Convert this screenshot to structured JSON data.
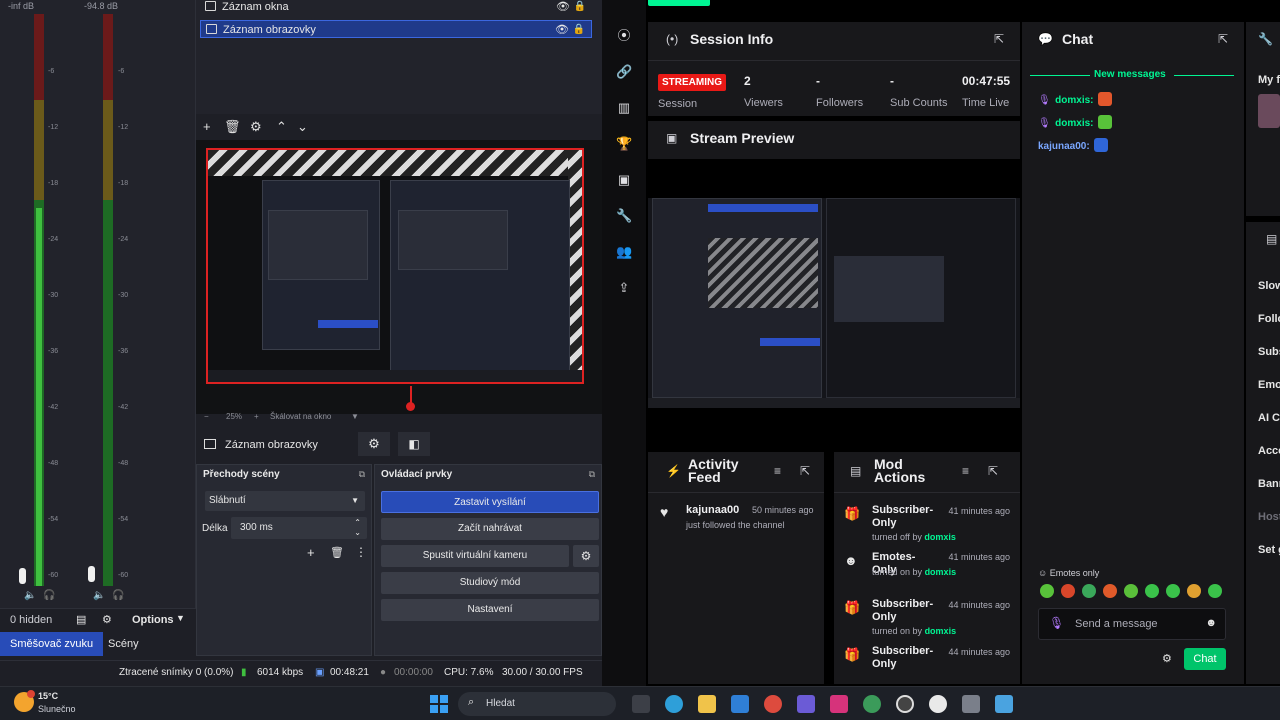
{
  "obs": {
    "mixer": {
      "meter1_head": "-inf dB",
      "meter2_head": "-94.8 dB",
      "ticks": [
        "-6",
        "-12",
        "-18",
        "-24",
        "-30",
        "-36",
        "-42",
        "-48",
        "-54",
        "-60"
      ],
      "hidden_label": "0 hidden",
      "options_label": "Options",
      "tab_mixer": "Směšovač zvuku",
      "tab_scenes": "Scény"
    },
    "sources": [
      {
        "label": "Záznam okna",
        "selected": false
      },
      {
        "label": "Záznam obrazovky",
        "selected": true
      }
    ],
    "zoom": {
      "percent": "25%",
      "scale_label": "Škálovat na okno"
    },
    "scene_source_label": "Záznam obrazovky",
    "transitions": {
      "title": "Přechody scény",
      "selected": "Slábnutí",
      "duration_label": "Délka",
      "duration_value": "300 ms"
    },
    "controls": {
      "title": "Ovládací prvky",
      "buttons": [
        "Zastavit vysílání",
        "Začít nahrávat",
        "Spustit virtuální kameru",
        "Studiový mód",
        "Nastavení"
      ]
    },
    "status": {
      "dropped": "Ztracené snímky 0 (0.0%)",
      "bitrate": "6014 kbps",
      "live_time": "00:48:21",
      "rec_time": "00:00:00",
      "cpu": "CPU: 7.6%",
      "fps": "30.00 / 30.00 FPS"
    }
  },
  "dashboard": {
    "session": {
      "title": "Session Info",
      "badge": "STREAMING",
      "badge_label": "Session",
      "viewers_value": "2",
      "viewers_label": "Viewers",
      "followers_value": "-",
      "followers_label": "Followers",
      "subs_value": "-",
      "subs_label": "Sub Counts",
      "time_value": "00:47:55",
      "time_label": "Time Live"
    },
    "preview_title": "Stream Preview",
    "activity": {
      "title": "Activity Feed",
      "items": [
        {
          "name": "kajunaa00",
          "time": "50 minutes ago",
          "sub": "just followed the channel"
        }
      ]
    },
    "mod": {
      "title": "Mod Actions",
      "items": [
        {
          "action": "Subscriber-Only",
          "verb": "turned off by",
          "user": "domxis",
          "time": "41 minutes ago"
        },
        {
          "action": "Emotes-Only",
          "verb": "turned on by",
          "user": "domxis",
          "time": "41 minutes ago"
        },
        {
          "action": "Subscriber-Only",
          "verb": "turned on by",
          "user": "domxis",
          "time": "44 minutes ago"
        },
        {
          "action": "Subscriber-Only",
          "verb": "",
          "user": "",
          "time": "44 minutes ago"
        }
      ]
    },
    "chat": {
      "title": "Chat",
      "new_messages": "New messages",
      "messages": [
        {
          "user": "domxis:",
          "color": "#00f593"
        },
        {
          "user": "domxis:",
          "color": "#00f593"
        },
        {
          "user": "kajunaa00:",
          "color": "#7aa7ff"
        }
      ],
      "emotes_only": "Emotes only",
      "placeholder": "Send a message",
      "chat_button": "Chat"
    },
    "right_panel": {
      "head": "My f",
      "items": [
        "Slow",
        "Follo",
        "Subs",
        "Emo",
        "AI Ch",
        "Acco",
        "Bann",
        "Host",
        "Set g"
      ]
    }
  },
  "taskbar": {
    "temp": "15°C",
    "weather": "Slunečno",
    "search_placeholder": "Hledat"
  }
}
